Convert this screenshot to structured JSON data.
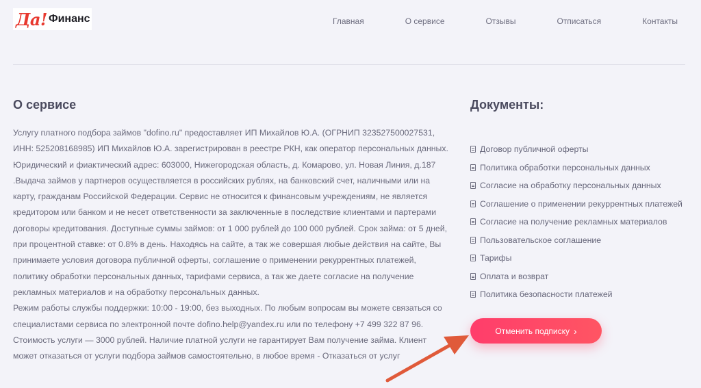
{
  "header": {
    "logo_part1": "Да!",
    "logo_part2": "Финанс",
    "nav": [
      "Главная",
      "О сервисе",
      "Отзывы",
      "Отписаться",
      "Контакты"
    ]
  },
  "about": {
    "title": "О сервисе",
    "paragraph1": "Услугу платного подбора займов \"dofino.ru\" предоставляет ИП Михайлов Ю.А. (ОГРНИП 323527500027531, ИНН: 525208168985) ИП Михайлов Ю.А. зарегистрирован в реестре РКН, как оператор персональных данных. Юридический и фиактический адрес: 603000, Нижегородская область, д. Комарово, ул. Новая Линия, д.187 .Выдача займов у партнеров осуществляется в российских рублях, на банковский счет, наличными или на карту, гражданам Российской Федерации. Сервис не относится к финансовым учреждениям, не является кредитором или банком и не несет ответственности за заключенные в последствие клиентами и партерами договоры кредитования. Доступные суммы займов: от 1 000 рублей до 100 000 рублей. Срок займа: от 5 дней, при процентной ставке: от 0.8% в день. Находясь на сайте, а так же совершая любые действия на сайте, Вы принимаете условия договора публичной оферты, соглашение о применении рекуррентных платежей, политику обработки персональных данных, тарифами сервиса, а так же даете согласие на получение рекламных материалов и на обработку персональных данных.",
    "paragraph2": "Режим работы службы поддержки: 10:00 - 19:00, без выходных. По любым вопросам вы можете связаться со специалистами сервиса по электронной почте dofino.help@yandex.ru или по телефону +7 499 322 87 96. Стоимость услуги — 3000 рублей. Наличие платной услуги не гарантирует Вам получение займа. Клиент может отказаться от услуги подбора займов самостоятельно, в любое время - Отказаться от услуг"
  },
  "documents": {
    "title": "Документы:",
    "items": [
      "Договор публичной оферты",
      "Политика обработки персональных данных",
      "Согласие на обработку персональных данных",
      "Соглашение о применении рекуррентных платежей",
      "Согласие на получение рекламных материалов",
      "Пользовательское соглашение",
      "Тарифы",
      "Оплата и возврат",
      "Политика безопасности платежей"
    ],
    "icon": "document-icon"
  },
  "unsubscribe_button": {
    "label": "Отменить подписку",
    "chevron": "›"
  },
  "colors": {
    "background": "#f3f3f9",
    "accent": "#ff3d6b",
    "arrow": "#e05a3a",
    "logo_red": "#e8392f"
  }
}
